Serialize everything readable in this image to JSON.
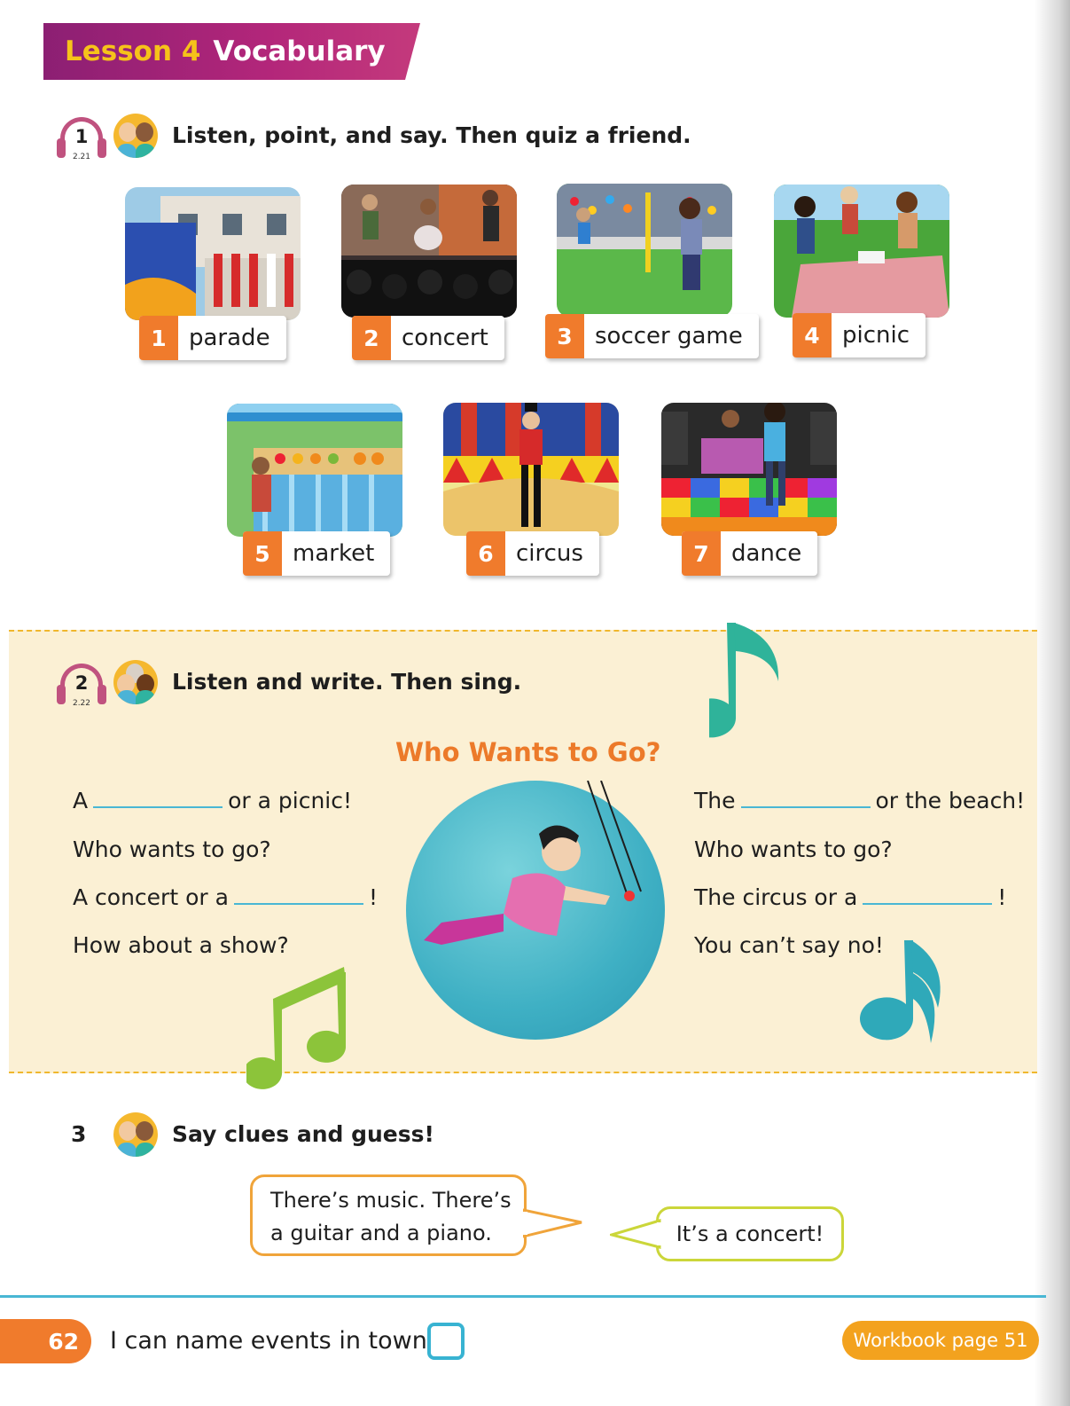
{
  "header": {
    "lesson_label": "Lesson 4",
    "lesson_title": "Vocabulary"
  },
  "activity1": {
    "number": "1",
    "track": "2.21",
    "instruction": "Listen, point, and say. Then quiz a friend.",
    "items": [
      {
        "num": "1",
        "word": "parade"
      },
      {
        "num": "2",
        "word": "concert"
      },
      {
        "num": "3",
        "word": "soccer game"
      },
      {
        "num": "4",
        "word": "picnic"
      },
      {
        "num": "5",
        "word": "market"
      },
      {
        "num": "6",
        "word": "circus"
      },
      {
        "num": "7",
        "word": "dance"
      }
    ]
  },
  "activity2": {
    "number": "2",
    "track": "2.22",
    "instruction": "Listen and write. Then sing.",
    "song_title": "Who Wants to Go?",
    "left_lines": [
      {
        "before": "A",
        "after": "or a picnic!"
      },
      {
        "text": "Who wants to go?"
      },
      {
        "before": "A concert or a",
        "after": "!"
      },
      {
        "text": "How about a show?"
      }
    ],
    "right_lines": [
      {
        "before": "The",
        "after": "or the beach!"
      },
      {
        "text": "Who wants to go?"
      },
      {
        "before": "The circus or a",
        "after": "!"
      },
      {
        "text": "You can’t say no!"
      }
    ]
  },
  "activity3": {
    "number": "3",
    "instruction": "Say clues and guess!",
    "bubble_clue_line1": "There’s music. There’s",
    "bubble_clue_line2": "a guitar and a piano.",
    "bubble_answer": "It’s a concert!"
  },
  "footer": {
    "page_number": "62",
    "can_do": "I can name events in town.",
    "workbook": "Workbook page 51"
  },
  "colors": {
    "banner": "#b3267a",
    "accent_orange": "#f07b2c",
    "accent_blue": "#49b7d4",
    "song_band": "#fbf0d4"
  }
}
